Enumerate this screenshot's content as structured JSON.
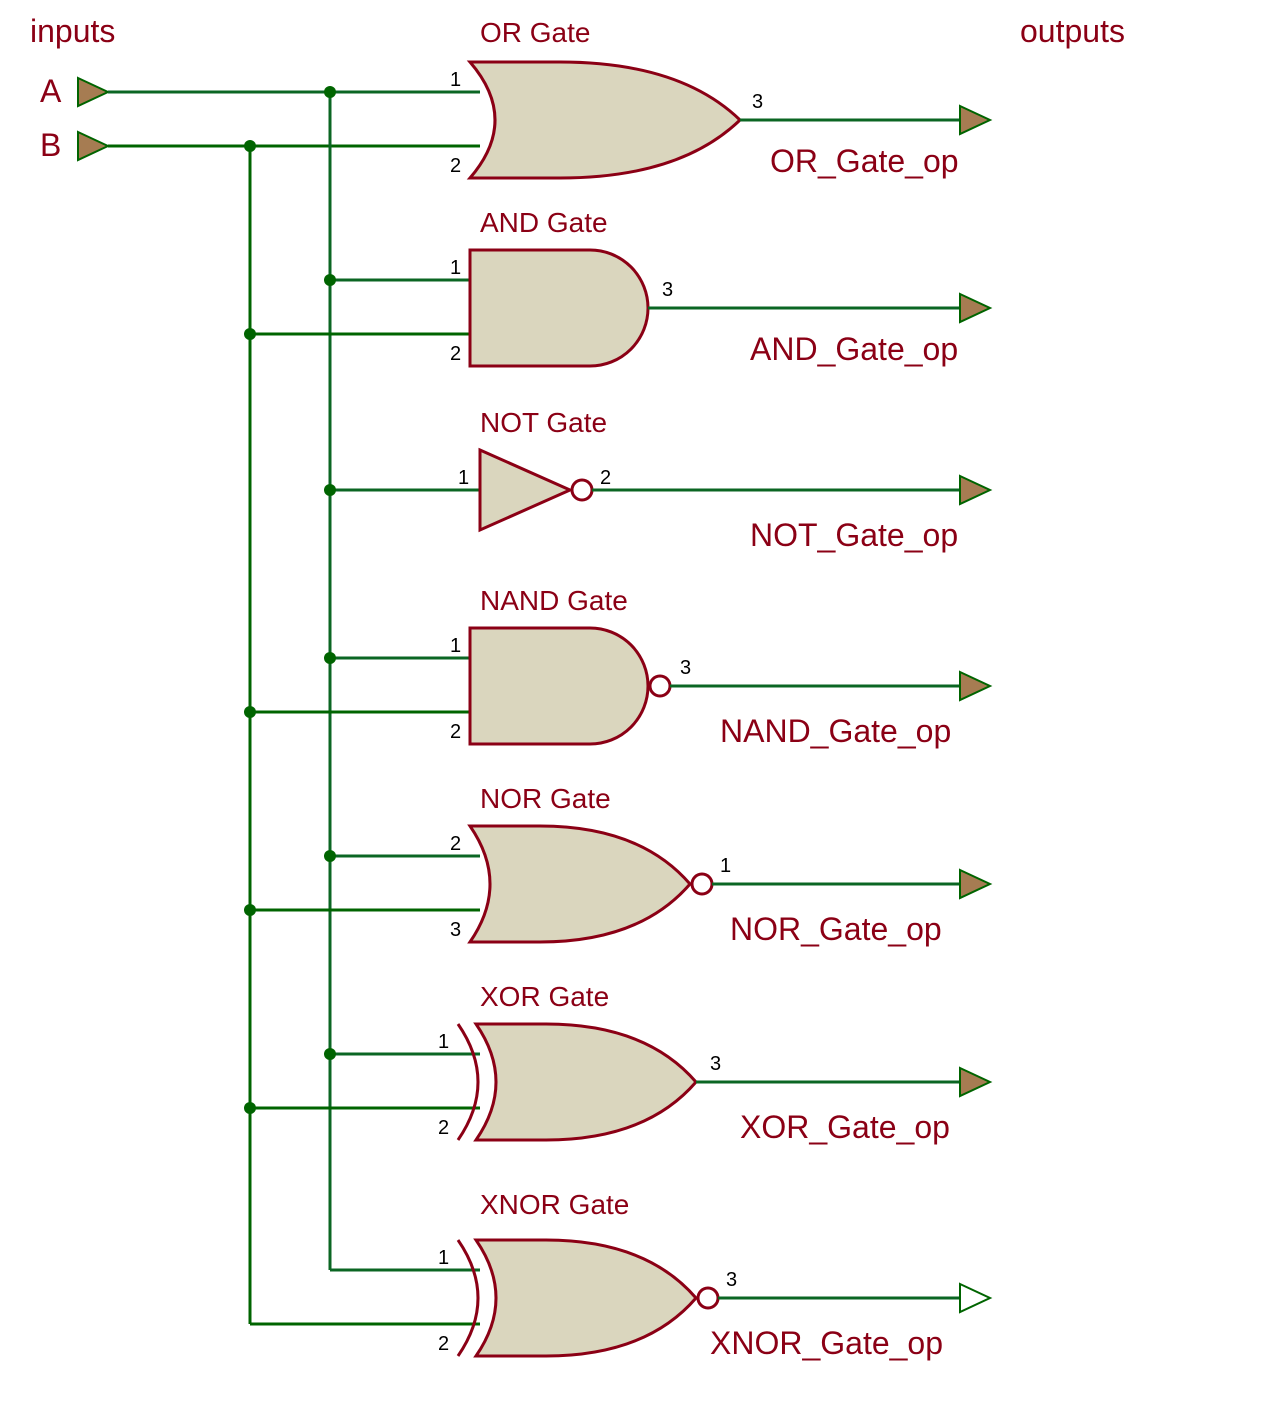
{
  "headers": {
    "inputs": "inputs",
    "outputs": "outputs"
  },
  "inputs": {
    "a": "A",
    "b": "B"
  },
  "gates": {
    "or": {
      "title": "OR Gate",
      "pin1": "1",
      "pin2": "2",
      "pin_out": "3",
      "output_label": "OR_Gate_op"
    },
    "and": {
      "title": "AND Gate",
      "pin1": "1",
      "pin2": "2",
      "pin_out": "3",
      "output_label": "AND_Gate_op"
    },
    "not": {
      "title": "NOT Gate",
      "pin1": "1",
      "pin_out": "2",
      "output_label": "NOT_Gate_op"
    },
    "nand": {
      "title": "NAND Gate",
      "pin1": "1",
      "pin2": "2",
      "pin_out": "3",
      "output_label": "NAND_Gate_op"
    },
    "nor": {
      "title": "NOR Gate",
      "pin1": "2",
      "pin2": "3",
      "pin_out": "1",
      "output_label": "NOR_Gate_op"
    },
    "xor": {
      "title": "XOR Gate",
      "pin1": "1",
      "pin2": "2",
      "pin_out": "3",
      "output_label": "XOR_Gate_op"
    },
    "xnor": {
      "title": "XNOR Gate",
      "pin1": "1",
      "pin2": "2",
      "pin_out": "3",
      "output_label": "XNOR_Gate_op"
    }
  },
  "colors": {
    "wire": "#006400",
    "label": "#8B0015",
    "gate_fill": "#DAD6BE"
  }
}
